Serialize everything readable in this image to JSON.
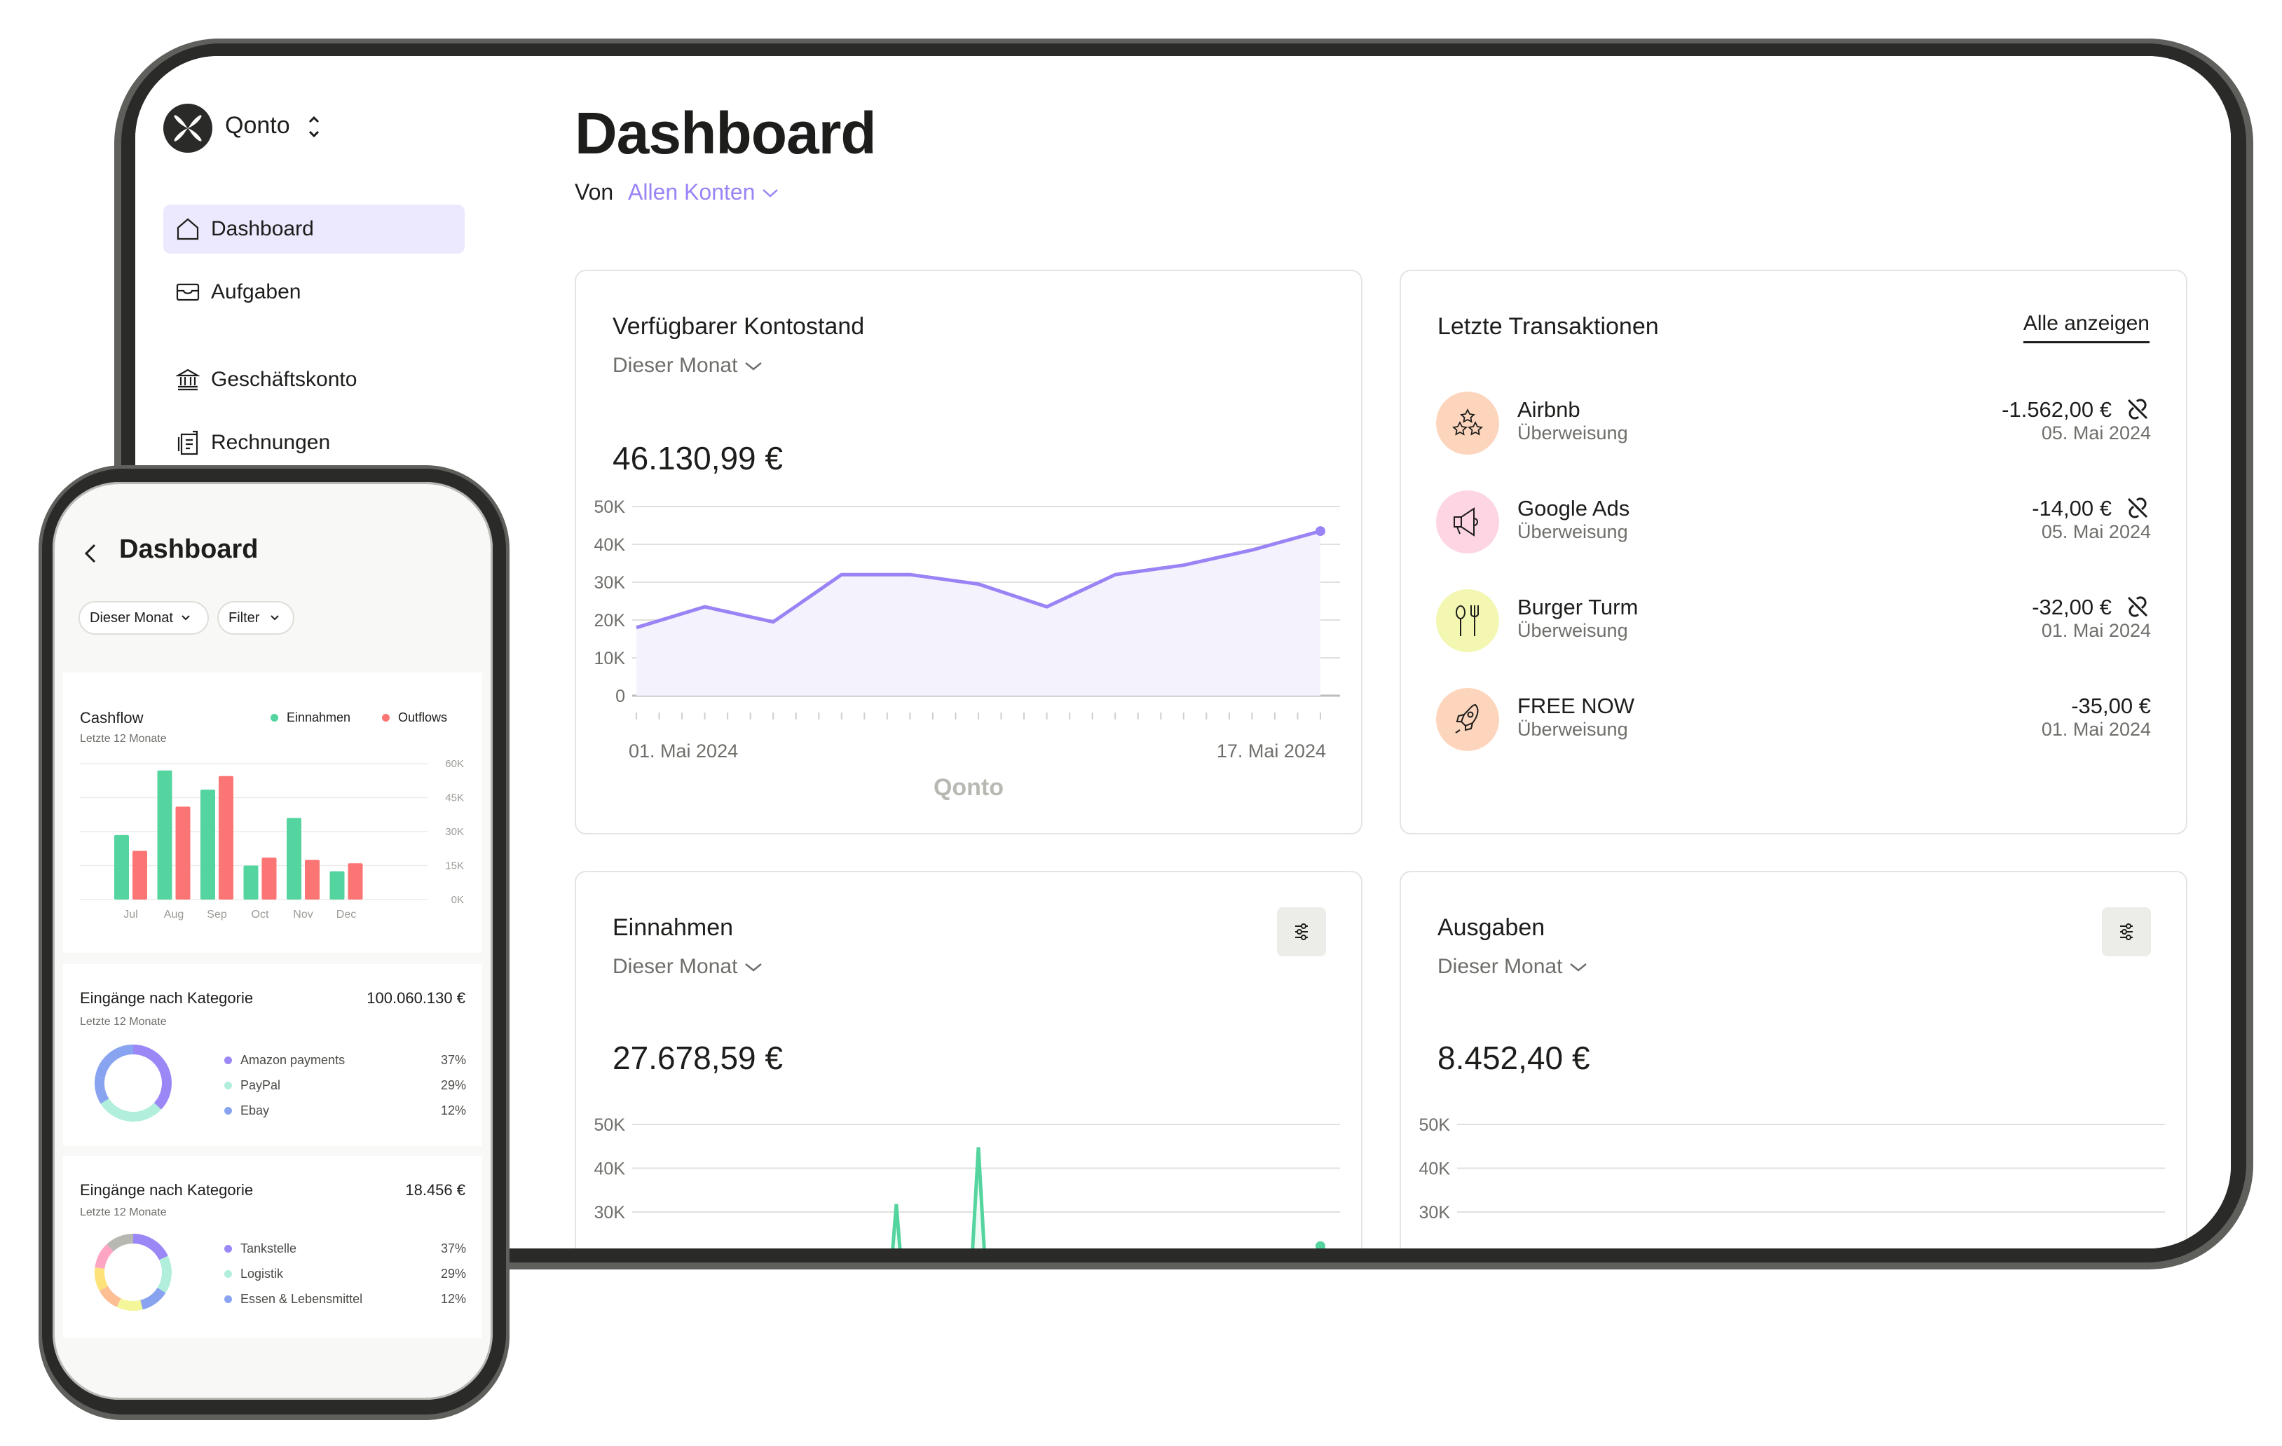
{
  "tablet": {
    "sidebar": {
      "org_name": "Qonto",
      "logo_icon": "qonto-logo",
      "items": [
        {
          "label": "Dashboard",
          "icon": "home-icon",
          "active": true
        },
        {
          "label": "Aufgaben",
          "icon": "inbox-icon",
          "active": false
        },
        {
          "label": "Geschäftskonto",
          "icon": "bank-icon",
          "active": false
        },
        {
          "label": "Rechnungen",
          "icon": "invoice-icon",
          "active": false
        }
      ]
    },
    "header": {
      "title": "Dashboard",
      "from_label": "Von",
      "account_select": "Allen Konten"
    },
    "balance_card": {
      "title": "Verfügbarer Kontostand",
      "period": "Dieser Monat",
      "amount": "46.130,99 €",
      "watermark": "Qonto"
    },
    "transactions_card": {
      "title": "Letzte Transaktionen",
      "show_all": "Alle anzeigen",
      "items": [
        {
          "name": "Airbnb",
          "type": "Überweisung",
          "amount": "-1.562,00 €",
          "date": "05. Mai 2024",
          "icon": "stars-icon",
          "color": "#fdd5bd",
          "attachment_missing": true
        },
        {
          "name": "Google Ads",
          "type": "Überweisung",
          "amount": "-14,00 €",
          "date": "05. Mai 2024",
          "icon": "megaphone-icon",
          "color": "#fdd5e3",
          "attachment_missing": true
        },
        {
          "name": "Burger Turm",
          "type": "Überweisung",
          "amount": "-32,00 €",
          "date": "01. Mai 2024",
          "icon": "cutlery-icon",
          "color": "#f3f7b2",
          "attachment_missing": true
        },
        {
          "name": "FREE NOW",
          "type": "Überweisung",
          "amount": "-35,00 €",
          "date": "01. Mai 2024",
          "icon": "rocket-icon",
          "color": "#fdd5bd",
          "attachment_missing": false
        }
      ]
    },
    "income_card": {
      "title": "Einnahmen",
      "period": "Dieser Monat",
      "amount": "27.678,59 €"
    },
    "expenses_card": {
      "title": "Ausgaben",
      "period": "Dieser Monat",
      "amount": "8.452,40 €"
    }
  },
  "phone": {
    "title": "Dashboard",
    "chips": [
      "Dieser Monat",
      "Filter"
    ],
    "cashflow": {
      "title": "Cashflow",
      "subtitle": "Letzte 12 Monate",
      "legend": [
        "Einnahmen",
        "Outflows"
      ]
    },
    "income_by_category": {
      "title": "Eingänge nach Kategorie",
      "subtitle": "Letzte 12 Monate",
      "total": "100.060.130 €",
      "items": [
        {
          "label": "Amazon payments",
          "pct": "37%",
          "color": "#9b87f5"
        },
        {
          "label": "PayPal",
          "pct": "29%",
          "color": "#b1eedb"
        },
        {
          "label": "Ebay",
          "pct": "12%",
          "color": "#88a3f0"
        }
      ]
    },
    "category_2": {
      "title": "Eingänge nach Kategorie",
      "subtitle": "Letzte 12 Monate",
      "total": "18.456 €",
      "items": [
        {
          "label": "Tankstelle",
          "pct": "37%",
          "color": "#9b87f5"
        },
        {
          "label": "Logistik",
          "pct": "29%",
          "color": "#b1eedb"
        },
        {
          "label": "Essen & Lebensmittel",
          "pct": "12%",
          "color": "#88a3f0"
        }
      ]
    }
  },
  "colors": {
    "accent": "#9a83f5",
    "income": "#54d49e",
    "outflow": "#fb7574",
    "active_nav_bg": "#ece8fd"
  },
  "chart_data": [
    {
      "id": "balance",
      "type": "area",
      "title": "Verfügbarer Kontostand",
      "xlabel": "",
      "ylabel": "",
      "x_tick_labels": [
        "01. Mai 2024",
        "17. Mai 2024"
      ],
      "y_ticks": [
        "0",
        "10K",
        "20K",
        "30K",
        "40K",
        "50K"
      ],
      "ylim": [
        0,
        50000
      ],
      "grid": true,
      "series": [
        {
          "name": "Kontostand",
          "values": [
            18000,
            23500,
            19500,
            32000,
            32000,
            29500,
            23500,
            32000,
            34500,
            38500,
            43500
          ]
        }
      ],
      "tick_count": 31
    },
    {
      "id": "income",
      "type": "area",
      "title": "Einnahmen",
      "y_ticks": [
        "30K",
        "40K",
        "50K"
      ],
      "ylim": [
        20000,
        50000
      ],
      "grid": true,
      "visible_peaks": [
        {
          "x_frac": 0.38,
          "value": 31800
        },
        {
          "x_frac": 0.5,
          "value": 44800
        }
      ],
      "end_point": {
        "x_frac": 1.0,
        "value": 22200
      }
    },
    {
      "id": "expenses",
      "type": "line",
      "title": "Ausgaben",
      "y_ticks": [
        "30K",
        "40K",
        "50K"
      ],
      "ylim": [
        20000,
        50000
      ],
      "grid": true
    },
    {
      "id": "cashflow",
      "type": "bar",
      "title": "Cashflow",
      "subtitle": "Letzte 12 Monate",
      "categories": [
        "Jul",
        "Aug",
        "Sep",
        "Oct",
        "Nov",
        "Dec"
      ],
      "series": [
        {
          "name": "Einnahmen",
          "color": "#54d49e",
          "values": [
            28500,
            57000,
            48500,
            15000,
            36000,
            12500
          ]
        },
        {
          "name": "Outflows",
          "color": "#fb7574",
          "values": [
            21500,
            41000,
            54500,
            18500,
            17500,
            16000
          ]
        }
      ],
      "y_ticks": [
        "0K",
        "15K",
        "30K",
        "45K",
        "60K"
      ],
      "ylim": [
        0,
        60000
      ],
      "legend": "top-right"
    },
    {
      "id": "income_donut",
      "type": "pie",
      "labels": [
        "Amazon payments",
        "PayPal",
        "Ebay",
        "Other"
      ],
      "values": [
        37,
        29,
        12,
        22
      ],
      "colors": [
        "#9b87f5",
        "#b1eedb",
        "#88a3f0",
        "#88a3f0"
      ]
    },
    {
      "id": "category_donut",
      "type": "pie",
      "labels": [
        "Tankstelle",
        "Logistik",
        "Essen & Lebensmittel",
        "Other 1",
        "Other 2",
        "Other 3",
        "Other 4",
        "Other 5"
      ],
      "values": [
        18,
        16,
        12,
        11,
        10,
        10,
        11,
        12
      ],
      "colors": [
        "#9b87f5",
        "#b1eedb",
        "#88a3f0",
        "#f3f79a",
        "#fdbe94",
        "#fde27a",
        "#fda5c3",
        "#b8b8b3"
      ]
    }
  ]
}
